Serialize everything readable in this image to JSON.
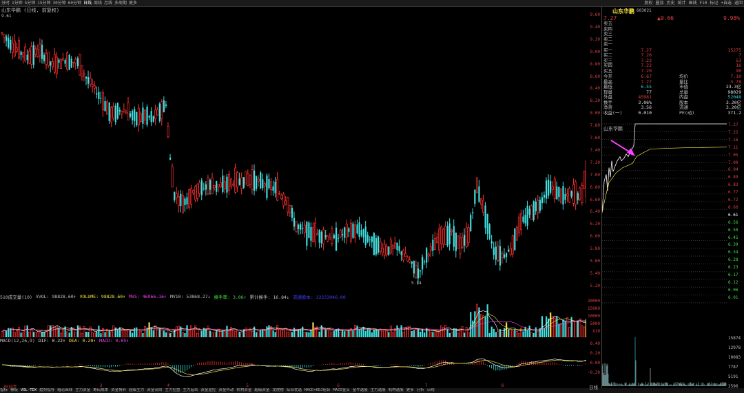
{
  "toolbar": {
    "period_tabs": [
      "分时",
      "1分钟",
      "5分钟",
      "15分钟",
      "30分钟",
      "60分钟",
      "日线",
      "周线",
      "月线",
      "多周期",
      "更多"
    ],
    "active_period": "日线",
    "right_tools": [
      "复权",
      "叠加",
      "历史",
      "统计",
      "画线",
      "F10",
      "标记",
      "+自选",
      "返回"
    ]
  },
  "chart": {
    "title": "山东华鹏 (日线, 前复权)",
    "high_label": "9.61",
    "low_label": "5.14",
    "price_axis": [
      "9.60",
      "9.40",
      "9.20",
      "9.00",
      "8.80",
      "8.60",
      "8.40",
      "8.20",
      "8.00",
      "7.80",
      "7.60",
      "7.40",
      "7.20",
      "7.00",
      "6.80",
      "6.60",
      "6.40",
      "6.20",
      "6.00",
      "5.80",
      "5.60",
      "5.40",
      "5.20"
    ],
    "colors": {
      "up": "#ff3030",
      "down": "#40e0e0",
      "ma5": "#ffffff",
      "ma10": "#f0e040",
      "ma20": "#ff40ff"
    }
  },
  "volume": {
    "header": {
      "label": "510成交量(10)",
      "vvol": "VVOL: 98828.60↑",
      "volume": "VOLUME: 98828.60↑",
      "mv5": "MV5: 46966.16↑",
      "mv10": "MV10: 53868.27↓",
      "turnover": "换手率: 3.06↑",
      "cum_turnover": "累计换手: 16.84↓",
      "extra": "流通股本: 32233046.00"
    },
    "axis": [
      "20000",
      "15000",
      "10000",
      "5000",
      "X10"
    ]
  },
  "macd": {
    "header": {
      "label": "MACD(12,26,9)",
      "dif": "DIF: 0.22↑",
      "dea": "DEA: 0.20↑",
      "macd": "MACD: 0.05↑"
    },
    "axis": [
      "0.40",
      "0.20",
      "0.00",
      "-0.20"
    ]
  },
  "dates": [
    {
      "text": "2019年",
      "pos": 0.005
    },
    {
      "text": "3",
      "pos": 0.17
    },
    {
      "text": "4",
      "pos": 0.285
    },
    {
      "text": "5",
      "pos": 0.42
    },
    {
      "text": "6",
      "pos": 0.575
    },
    {
      "text": "7",
      "pos": 0.725
    },
    {
      "text": "8",
      "pos": 0.855
    }
  ],
  "bottom_tabs": [
    "指标",
    "模板",
    "VOL-TDX",
    "趋势指导",
    "缠论画线",
    "主力资金",
    "筹码成本",
    "资金博弈",
    "超级主力",
    "资金流向",
    "主力控盘",
    "主力追击",
    "资金监控",
    "资金异动",
    "机构资金",
    "超级资金",
    "龙虎榜",
    "综合优选",
    "MACD+KDJ组合",
    "MACD金叉",
    "金牛选股",
    "主力选股",
    "机构选股",
    "更多",
    "分析",
    "日线"
  ],
  "active_bottom_tab": "VOL-TDX",
  "quote": {
    "name": "山东华鹏",
    "code": "603021",
    "price": "7.27",
    "change": "▲0.66",
    "pct": "9.98%",
    "sell": [
      {
        "label": "卖五",
        "price": "",
        "vol": ""
      },
      {
        "label": "卖四",
        "price": "",
        "vol": ""
      },
      {
        "label": "卖三",
        "price": "",
        "vol": ""
      },
      {
        "label": "卖二",
        "price": "",
        "vol": ""
      },
      {
        "label": "卖一",
        "price": "",
        "vol": ""
      }
    ],
    "buy": [
      {
        "label": "买一",
        "price": "7.27",
        "vol": "15275"
      },
      {
        "label": "买二",
        "price": "7.26",
        "vol": "7"
      },
      {
        "label": "买三",
        "price": "7.23",
        "vol": "53"
      },
      {
        "label": "买四",
        "price": "7.22",
        "vol": "16"
      },
      {
        "label": "买五",
        "price": "7.20",
        "vol": "90"
      }
    ],
    "stats": [
      {
        "l1": "今开",
        "v1": "6.67",
        "l2": "均价",
        "v2": "7.10"
      },
      {
        "l1": "最高",
        "v1": "7.27",
        "l2": "量比",
        "v2": "3.78"
      },
      {
        "l1": "最低",
        "v1": "6.55",
        "l2": "市值",
        "v2": "23.3亿"
      },
      {
        "l1": "现量",
        "v1": "77",
        "l2": "总量",
        "v2": "98029"
      },
      {
        "l1": "外盘",
        "v1": "45981",
        "l2": "内盘",
        "v2": "52048"
      },
      {
        "l1": "换手",
        "v1": "3.06%",
        "l2": "股本",
        "v2": "3.20亿"
      },
      {
        "l1": "净资",
        "v1": "3.56",
        "l2": "流通",
        "v2": "3.20亿"
      },
      {
        "l1": "收益(一)",
        "v1": "0.010",
        "l2": "PE(动)",
        "v2": "371.2"
      }
    ]
  },
  "intraday": {
    "title": "山东华鹏",
    "axis": [
      "7.27",
      "7.22",
      "7.16",
      "7.11",
      "7.05",
      "7.00",
      "6.94",
      "6.89",
      "6.83",
      "6.77",
      "6.72",
      "6.66",
      "6.61",
      "6.56",
      "6.50",
      "6.45",
      "6.39",
      "6.34",
      "6.28",
      "6.23",
      "6.17",
      "6.12",
      "6.06",
      "6.01"
    ],
    "vol_axis": [
      "15874",
      "12978",
      "10083",
      "7787",
      "5191",
      "2596"
    ],
    "bottom_label": "日线"
  }
}
